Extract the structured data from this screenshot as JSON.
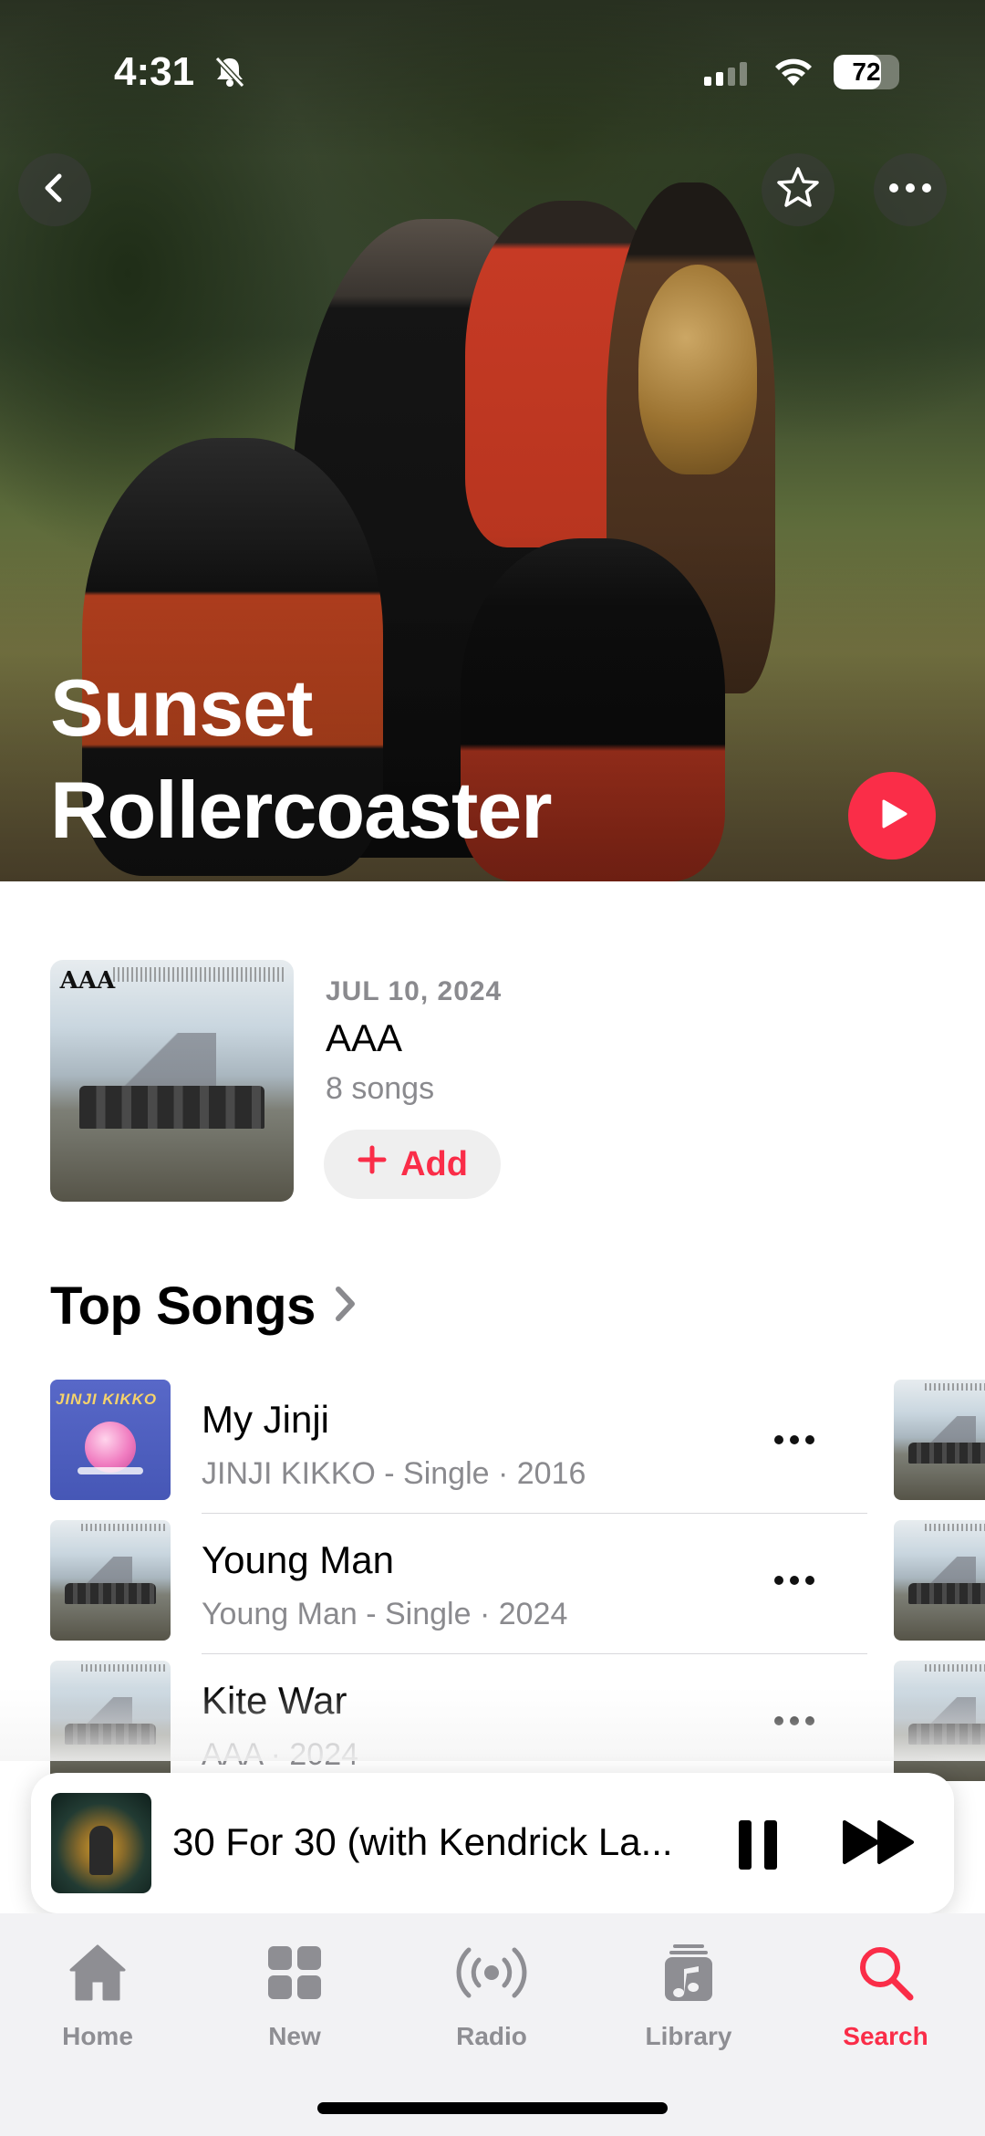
{
  "status_bar": {
    "time": "4:31",
    "battery": "72",
    "battery_level": 0.72,
    "icons": [
      "bell-slash-icon",
      "signal-icon",
      "wifi-icon",
      "battery-icon"
    ]
  },
  "header": {
    "artist_name": "Sunset Rollercoaster",
    "icons": [
      "chevron-left-icon",
      "star-icon",
      "ellipsis-icon",
      "play-icon"
    ]
  },
  "latest_release": {
    "date": "JUL 10, 2024",
    "title": "AAA",
    "song_count": "8 songs",
    "add_label": "Add",
    "cover_logo": "AAA"
  },
  "top_songs": {
    "heading": "Top Songs",
    "songs": [
      {
        "title": "My Jinji",
        "subtitle": "JINJI KIKKO - Single · 2016",
        "art_text": "JINJI KIKKO"
      },
      {
        "title": "Young Man",
        "subtitle": "Young Man - Single · 2024"
      },
      {
        "title": "Kite War",
        "subtitle": "AAA · 2024"
      }
    ]
  },
  "now_playing": {
    "track": "30 For 30 (with Kendrick La...",
    "icons": [
      "pause-icon",
      "forward-icon"
    ]
  },
  "tab_bar": {
    "tabs": [
      {
        "label": "Home",
        "icon": "house-icon",
        "active": false
      },
      {
        "label": "New",
        "icon": "grid-icon",
        "active": false
      },
      {
        "label": "Radio",
        "icon": "radio-waves-icon",
        "active": false
      },
      {
        "label": "Library",
        "icon": "music-note-stack-icon",
        "active": false
      },
      {
        "label": "Search",
        "icon": "magnifying-glass-icon",
        "active": true
      }
    ]
  },
  "colors": {
    "accent": "#fa2d48",
    "secondary_text": "#8a8a8e",
    "tab_inactive": "#8e8e93",
    "tab_bar_bg": "#f2f2f4"
  }
}
